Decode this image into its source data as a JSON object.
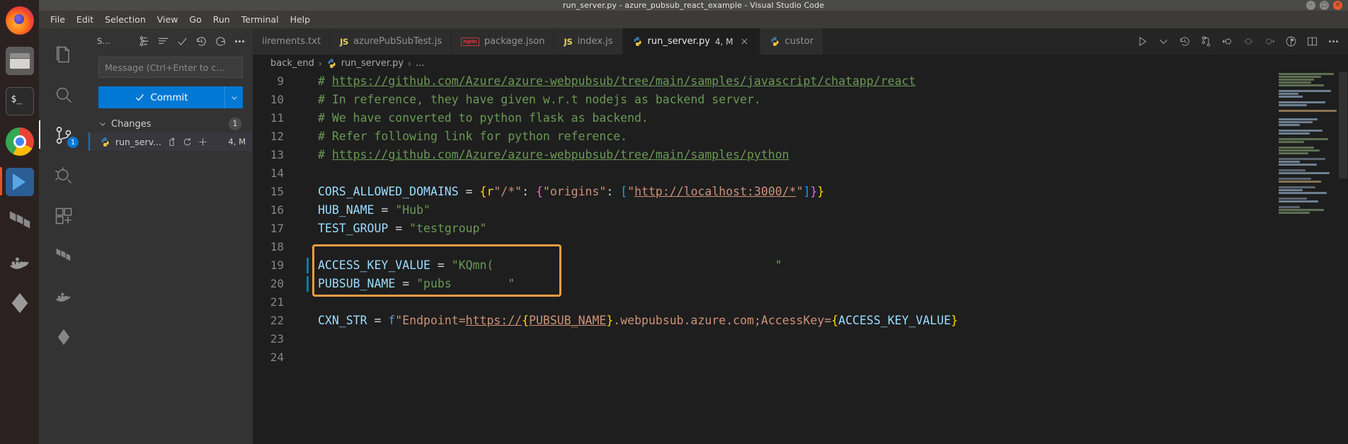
{
  "window": {
    "title": "run_server.py - azure_pubsub_react_example - Visual Studio Code",
    "buttons": {
      "minimize": "–",
      "maximize": "□",
      "close": "×"
    }
  },
  "menubar": {
    "items": [
      {
        "label": "File"
      },
      {
        "label": "Edit"
      },
      {
        "label": "Selection"
      },
      {
        "label": "View"
      },
      {
        "label": "Go"
      },
      {
        "label": "Run"
      },
      {
        "label": "Terminal"
      },
      {
        "label": "Help"
      }
    ]
  },
  "dock": {
    "items": [
      {
        "name": "firefox",
        "label": "Firefox"
      },
      {
        "name": "files",
        "label": "Files"
      },
      {
        "name": "terminal",
        "label": "Terminal"
      },
      {
        "name": "chrome",
        "label": "Google Chrome"
      },
      {
        "name": "vscode",
        "label": "Visual Studio Code"
      },
      {
        "name": "terraform",
        "label": "Terraform"
      },
      {
        "name": "docker",
        "label": "Docker"
      },
      {
        "name": "vault",
        "label": "Vault"
      }
    ]
  },
  "activitybar": {
    "items": [
      {
        "name": "explorer",
        "label": "Explorer",
        "badge": ""
      },
      {
        "name": "search",
        "label": "Search",
        "badge": ""
      },
      {
        "name": "source-control",
        "label": "Source Control",
        "badge": "1"
      },
      {
        "name": "run-and-debug",
        "label": "Run and Debug",
        "badge": ""
      },
      {
        "name": "extensions",
        "label": "Extensions",
        "badge": ""
      },
      {
        "name": "terraform",
        "label": "Terraform",
        "badge": ""
      },
      {
        "name": "docker",
        "label": "Docker",
        "badge": ""
      },
      {
        "name": "vault",
        "label": "Vault",
        "badge": ""
      }
    ]
  },
  "sidebar": {
    "title": "S...",
    "header_actions": [
      {
        "name": "view-as-tree-icon",
        "label": "View as Tree"
      },
      {
        "name": "more-actions-list-icon",
        "label": "Views and More Actions"
      },
      {
        "name": "commit-check-icon",
        "label": "Commit"
      },
      {
        "name": "history-icon",
        "label": "View History"
      },
      {
        "name": "refresh-icon",
        "label": "Refresh"
      },
      {
        "name": "ellipsis-icon",
        "label": "More Actions"
      }
    ],
    "commit_message": {
      "placeholder": "Message (Ctrl+Enter to c…",
      "value": ""
    },
    "commit_button": {
      "label": "Commit",
      "dropdown": "⌄"
    },
    "changes": {
      "label": "Changes",
      "count": "1",
      "files": [
        {
          "name": "run_serv...",
          "badge": "4, M",
          "icon": "python-file-icon",
          "actions": [
            "open-file-icon",
            "discard-changes-icon",
            "stage-changes-icon"
          ]
        }
      ]
    }
  },
  "tabs": [
    {
      "name": "tab-requirements-txt",
      "label": "iirements.txt",
      "icon": "",
      "icon_kind": "none",
      "badge": "",
      "active": false,
      "closable": false
    },
    {
      "name": "tab-azurepubsubtest-js",
      "label": "azurePubSubTest.js",
      "icon": "JS",
      "icon_kind": "js",
      "badge": "",
      "active": false,
      "closable": false
    },
    {
      "name": "tab-package-json",
      "label": "package.json",
      "icon": "npm",
      "icon_kind": "npm",
      "badge": "",
      "active": false,
      "closable": false
    },
    {
      "name": "tab-index-js",
      "label": "index.js",
      "icon": "JS",
      "icon_kind": "js",
      "badge": "",
      "active": false,
      "closable": false
    },
    {
      "name": "tab-run-server-py",
      "label": "run_server.py",
      "icon": "py",
      "icon_kind": "py",
      "badge": "4, M",
      "active": true,
      "closable": true
    },
    {
      "name": "tab-custor-py",
      "label": "custor",
      "icon": "py",
      "icon_kind": "py",
      "badge": "",
      "active": false,
      "closable": false
    }
  ],
  "tab_actions": [
    {
      "name": "run-python-file-icon",
      "label": "Run Python File"
    },
    {
      "name": "run-dropdown-chevron-icon",
      "label": "Run options"
    },
    {
      "name": "timeline-history-icon",
      "label": "Timeline"
    },
    {
      "name": "source-control-compare-icon",
      "label": "Open Changes"
    },
    {
      "name": "previous-change-icon",
      "label": "Previous Change"
    },
    {
      "name": "current-change-icon",
      "label": "Current Change"
    },
    {
      "name": "next-change-icon",
      "label": "Next Change"
    },
    {
      "name": "debug-alt-icon",
      "label": "Debug"
    },
    {
      "name": "split-editor-icon",
      "label": "Split Editor"
    },
    {
      "name": "more-editor-actions-icon",
      "label": "More Actions..."
    }
  ],
  "breadcrumb": {
    "items": [
      {
        "label": "back_end",
        "icon": ""
      },
      {
        "label": "run_server.py",
        "icon": "python-file-icon"
      },
      {
        "label": "...",
        "icon": ""
      }
    ],
    "separator": "›"
  },
  "editor": {
    "language": "python",
    "first_visible_line": 9,
    "lines": [
      {
        "n": "9",
        "modified": false,
        "tokens": [
          {
            "t": "# ",
            "c": "c-comment"
          },
          {
            "t": "https://github.com/Azure/azure-webpubsub/tree/main/samples/javascript/chatapp/react",
            "c": "c-link"
          }
        ]
      },
      {
        "n": "10",
        "modified": false,
        "tokens": [
          {
            "t": "# In reference, they have given w.r.t nodejs as backend server.",
            "c": "c-comment"
          }
        ]
      },
      {
        "n": "11",
        "modified": false,
        "tokens": [
          {
            "t": "# We have converted to python flask as backend.",
            "c": "c-comment"
          }
        ]
      },
      {
        "n": "12",
        "modified": false,
        "tokens": [
          {
            "t": "# Refer following link for python reference.",
            "c": "c-comment"
          }
        ]
      },
      {
        "n": "13",
        "modified": false,
        "tokens": [
          {
            "t": "# ",
            "c": "c-comment"
          },
          {
            "t": "https://github.com/Azure/azure-webpubsub/tree/main/samples/python",
            "c": "c-link"
          }
        ]
      },
      {
        "n": "14",
        "modified": false,
        "tokens": []
      },
      {
        "n": "15",
        "modified": false,
        "tokens": [
          {
            "t": "CORS_ALLOWED_DOMAINS",
            "c": "c-var"
          },
          {
            "t": " = ",
            "c": "c-op"
          },
          {
            "t": "{",
            "c": "c-brace-y"
          },
          {
            "t": "r",
            "c": "c-brace-y"
          },
          {
            "t": "\"/*\"",
            "c": "c-str"
          },
          {
            "t": ": ",
            "c": "c-op"
          },
          {
            "t": "{",
            "c": "c-brace-p"
          },
          {
            "t": "\"origins\"",
            "c": "c-str"
          },
          {
            "t": ": ",
            "c": "c-op"
          },
          {
            "t": "[",
            "c": "c-brace-b"
          },
          {
            "t": "\"",
            "c": "c-str"
          },
          {
            "t": "http://localhost:3000/*",
            "c": "c-url"
          },
          {
            "t": "\"",
            "c": "c-str"
          },
          {
            "t": "]",
            "c": "c-brace-b"
          },
          {
            "t": "}",
            "c": "c-brace-p"
          },
          {
            "t": "}",
            "c": "c-brace-y"
          }
        ]
      },
      {
        "n": "16",
        "modified": false,
        "tokens": [
          {
            "t": "HUB_NAME",
            "c": "c-var"
          },
          {
            "t": " = ",
            "c": "c-op"
          },
          {
            "t": "\"Hub\"",
            "c": "c-str-g"
          }
        ]
      },
      {
        "n": "17",
        "modified": false,
        "tokens": [
          {
            "t": "TEST_GROUP",
            "c": "c-var"
          },
          {
            "t": " = ",
            "c": "c-op"
          },
          {
            "t": "\"testgroup\"",
            "c": "c-str-g"
          }
        ]
      },
      {
        "n": "18",
        "modified": false,
        "tokens": []
      },
      {
        "n": "19",
        "modified": true,
        "tokens": [
          {
            "t": "ACCESS_KEY_VALUE",
            "c": "c-var"
          },
          {
            "t": " = ",
            "c": "c-op"
          },
          {
            "t": "\"KQmn(",
            "c": "c-str-g"
          },
          {
            "t": "                                        \"",
            "c": "c-str-g"
          }
        ]
      },
      {
        "n": "20",
        "modified": true,
        "tokens": [
          {
            "t": "PUBSUB_NAME",
            "c": "c-var"
          },
          {
            "t": " = ",
            "c": "c-op"
          },
          {
            "t": "\"pubs",
            "c": "c-str-g"
          },
          {
            "t": "        \"",
            "c": "c-str-g"
          }
        ]
      },
      {
        "n": "21",
        "modified": false,
        "tokens": []
      },
      {
        "n": "22",
        "modified": false,
        "tokens": [
          {
            "t": "CXN_STR",
            "c": "c-var"
          },
          {
            "t": " = ",
            "c": "c-op"
          },
          {
            "t": "f",
            "c": "c-kw"
          },
          {
            "t": "\"Endpoint=",
            "c": "c-str"
          },
          {
            "t": "https://",
            "c": "c-url"
          },
          {
            "t": "{",
            "c": "c-brace-y"
          },
          {
            "t": "PUBSUB_NAME",
            "c": "c-url"
          },
          {
            "t": "}",
            "c": "c-brace-y"
          },
          {
            "t": ".webpubsub.azure.com;AccessKey=",
            "c": "c-str"
          },
          {
            "t": "{",
            "c": "c-brace-y"
          },
          {
            "t": "ACCESS_KEY_VALUE",
            "c": "c-var"
          },
          {
            "t": "}",
            "c": "c-brace-y"
          }
        ]
      },
      {
        "n": "23",
        "modified": false,
        "tokens": []
      },
      {
        "n": "24",
        "modified": false,
        "tokens": []
      }
    ],
    "highlight": {
      "name": "redacted-credentials-highlight",
      "color": "#F59B42",
      "covers_lines": "19-20"
    }
  },
  "colors": {
    "accent": "#0078d4",
    "highlight": "#F59B42",
    "editor_bg": "#1e1e1e",
    "sidebar_bg": "#333333",
    "tab_inactive_bg": "#2d2d2d",
    "titlebar_bg": "#4a4a46"
  }
}
